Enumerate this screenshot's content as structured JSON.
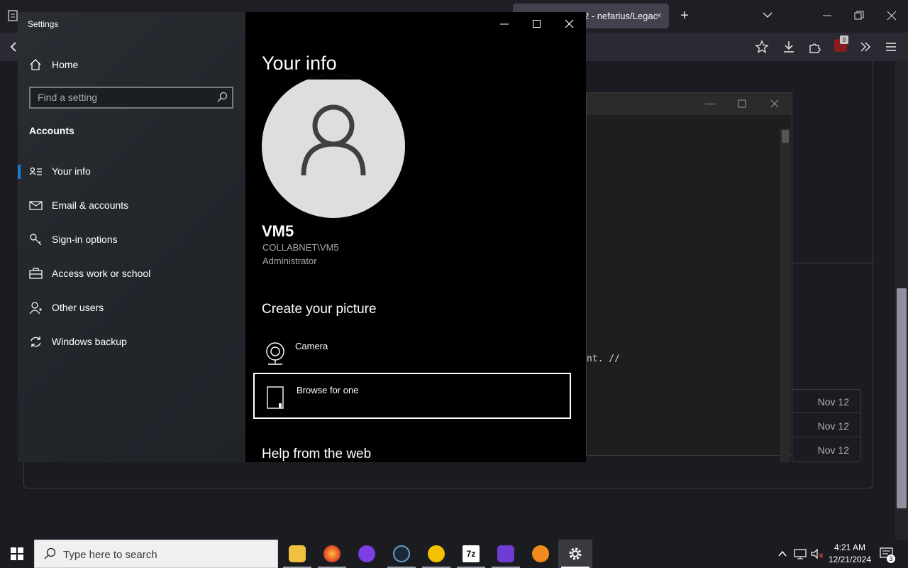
{
  "browser": {
    "tab_active_title": "2 - nefarius/Legac",
    "tab_close": "×",
    "new_tab": "+",
    "badge_count": "9"
  },
  "editor": {
    "code_fragment": "nt. //",
    "dates": [
      "Nov 12",
      "Nov 12",
      "Nov 12"
    ]
  },
  "settings": {
    "app_title": "Settings",
    "home_label": "Home",
    "search_placeholder": "Find a setting",
    "section_title": "Accounts",
    "nav": [
      {
        "label": "Your info",
        "icon": "contact-card-icon",
        "selected": true
      },
      {
        "label": "Email & accounts",
        "icon": "mail-icon",
        "selected": false
      },
      {
        "label": "Sign-in options",
        "icon": "key-icon",
        "selected": false
      },
      {
        "label": "Access work or school",
        "icon": "briefcase-icon",
        "selected": false
      },
      {
        "label": "Other users",
        "icon": "person-icon",
        "selected": false
      },
      {
        "label": "Windows backup",
        "icon": "sync-icon",
        "selected": false
      }
    ],
    "page_title": "Your info",
    "user": {
      "name": "VM5",
      "account": "COLLABNET\\VM5",
      "role": "Administrator"
    },
    "create_picture_heading": "Create your picture",
    "options": [
      {
        "label": "Camera",
        "icon": "webcam-icon"
      },
      {
        "label": "Browse for one",
        "icon": "file-icon"
      }
    ],
    "help_heading": "Help from the web"
  },
  "taskbar": {
    "search_placeholder": "Type here to search",
    "time": "4:21 AM",
    "date": "12/21/2024",
    "notification_count": "3"
  },
  "colors": {
    "accent": "#1a7fd4",
    "settings_right_bg": "#000000",
    "avatar_bg": "#dedede"
  }
}
